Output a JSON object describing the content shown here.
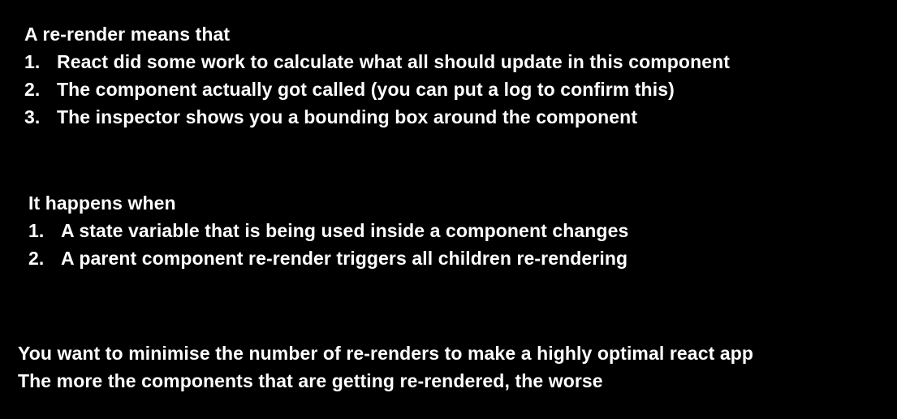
{
  "section1": {
    "heading": "A re-render means that",
    "items": [
      {
        "num": "1.",
        "text": "React did some work to calculate what all should update in this component"
      },
      {
        "num": "2.",
        "text": "The component actually got called (you can put a log to confirm this)"
      },
      {
        "num": "3.",
        "text": "The inspector shows you a bounding box around the component"
      }
    ]
  },
  "section2": {
    "heading": "It happens when",
    "items": [
      {
        "num": "1.",
        "text": "A state variable that is being used inside a component changes"
      },
      {
        "num": "2.",
        "text": "A parent component re-render triggers all children re-rendering"
      }
    ]
  },
  "section3": {
    "lines": [
      "You want to minimise the number of re-renders to make a highly optimal react app",
      "The more the components that are getting re-rendered, the worse"
    ]
  }
}
